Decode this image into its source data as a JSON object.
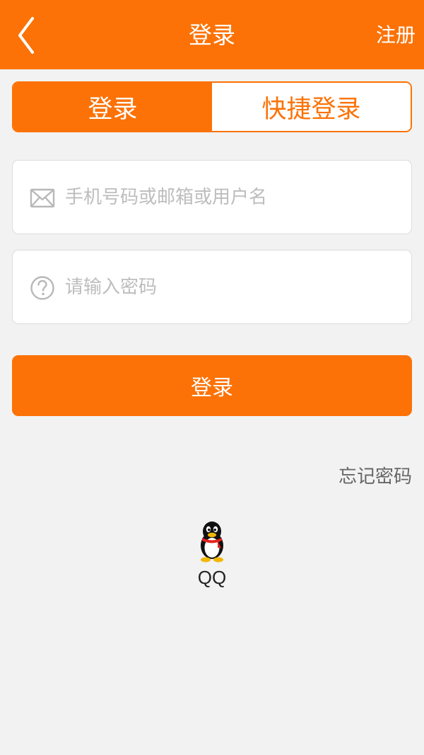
{
  "header": {
    "title": "登录",
    "register_label": "注册",
    "back_icon": "chevron-left-icon"
  },
  "tabs": [
    {
      "label": "登录",
      "active": true
    },
    {
      "label": "快捷登录",
      "active": false
    }
  ],
  "form": {
    "account": {
      "placeholder": "手机号码或邮箱或用户名",
      "value": "",
      "icon": "envelope-icon"
    },
    "password": {
      "placeholder": "请输入密码",
      "value": "",
      "icon": "question-circle-icon"
    },
    "login_label": "登录",
    "forgot_label": "忘记密码"
  },
  "social": {
    "qq_label": "QQ",
    "qq_icon": "qq-penguin-icon"
  },
  "colors": {
    "accent": "#fc7206",
    "background": "#f2f2f2",
    "placeholder": "#bdbdbd"
  }
}
